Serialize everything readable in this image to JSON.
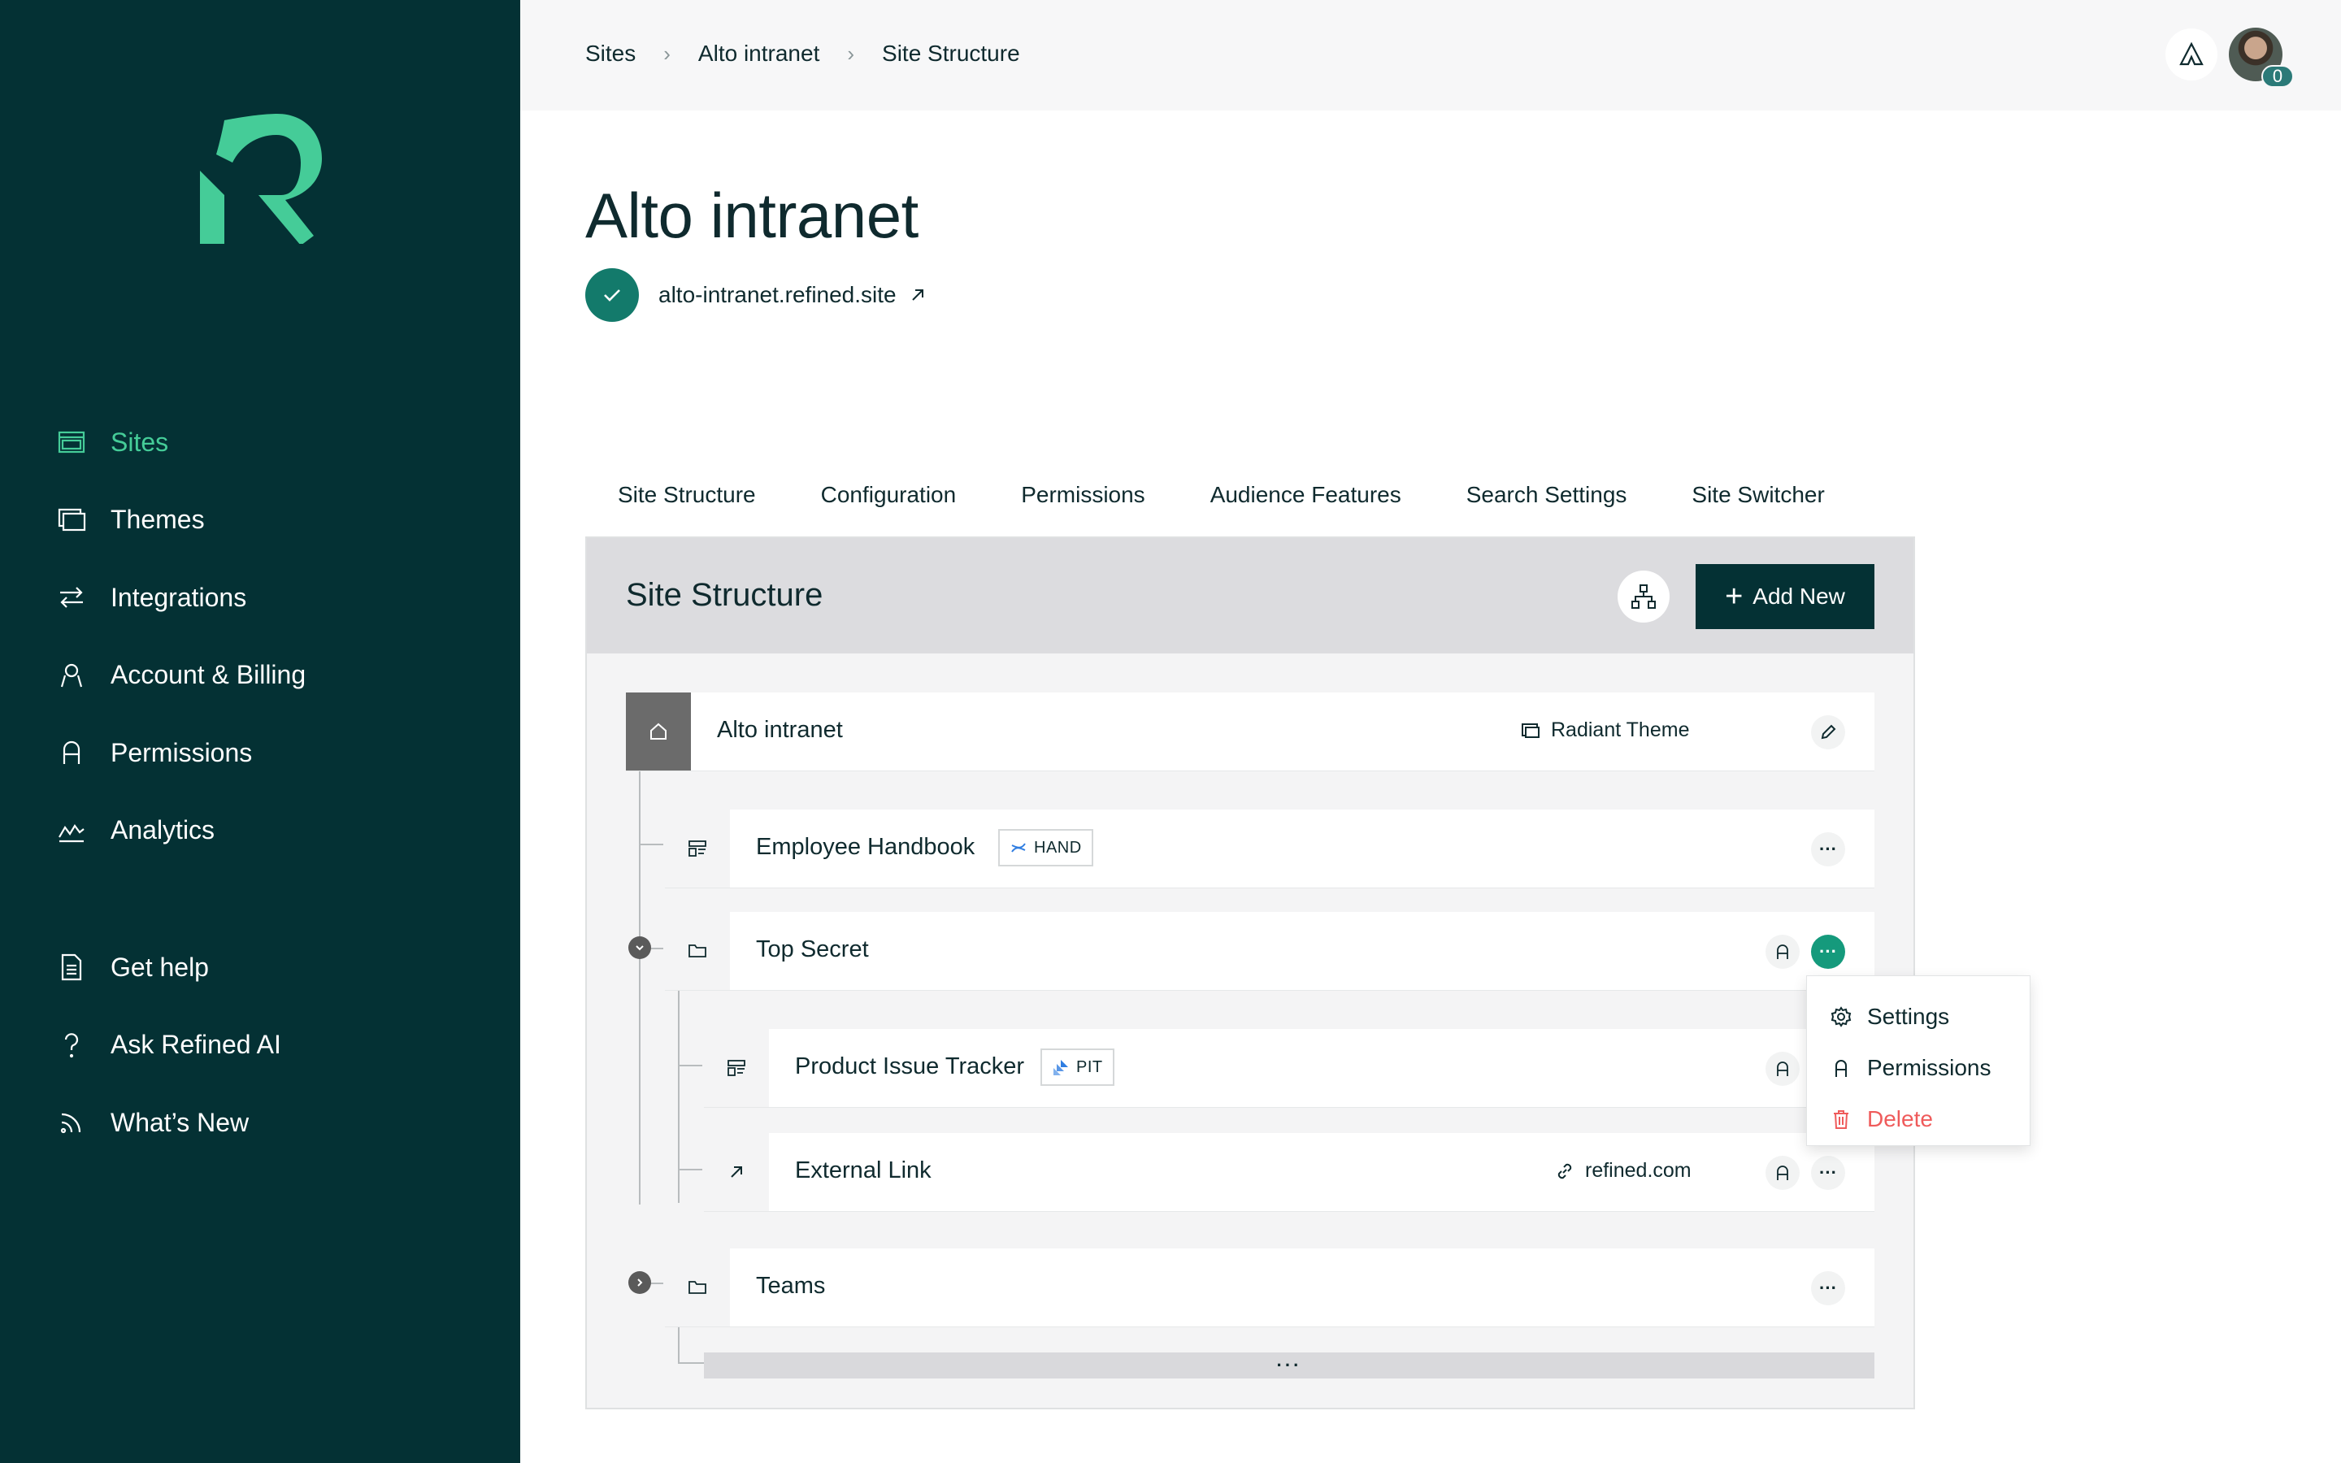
{
  "sidebar": {
    "brand_color": "#45cc98",
    "items": [
      {
        "label": "Sites",
        "icon": "sites-icon",
        "active": true
      },
      {
        "label": "Themes",
        "icon": "themes-icon"
      },
      {
        "label": "Integrations",
        "icon": "integrations-icon"
      },
      {
        "label": "Account & Billing",
        "icon": "account-icon"
      },
      {
        "label": "Permissions",
        "icon": "lock-icon"
      },
      {
        "label": "Analytics",
        "icon": "analytics-icon"
      }
    ],
    "help_items": [
      {
        "label": "Get help",
        "icon": "document-icon"
      },
      {
        "label": "Ask Refined AI",
        "icon": "question-icon"
      },
      {
        "label": "What’s New",
        "icon": "rss-icon"
      }
    ]
  },
  "breadcrumb": [
    "Sites",
    "Alto intranet",
    "Site Structure"
  ],
  "header": {
    "notification_count": "0"
  },
  "page": {
    "title": "Alto intranet",
    "url": "alto-intranet.refined.site"
  },
  "tabs": [
    {
      "label": "Site Structure",
      "active": true
    },
    {
      "label": "Configuration"
    },
    {
      "label": "Permissions"
    },
    {
      "label": "Audience Features"
    },
    {
      "label": "Search Settings"
    },
    {
      "label": "Site Switcher"
    }
  ],
  "panel": {
    "title": "Site Structure",
    "add_new_label": "Add New",
    "home": {
      "label": "Alto intranet",
      "theme": "Radiant Theme"
    },
    "rows": {
      "employee_handbook": {
        "label": "Employee Handbook",
        "tag": "HAND"
      },
      "top_secret": {
        "label": "Top Secret"
      },
      "product_issue_tracker": {
        "label": "Product Issue Tracker",
        "tag": "PIT"
      },
      "external_link": {
        "label": "External Link",
        "link": "refined.com"
      },
      "teams": {
        "label": "Teams"
      }
    },
    "more_label": "···"
  },
  "dropdown": {
    "items": [
      {
        "label": "Settings",
        "icon": "gear-icon"
      },
      {
        "label": "Permissions",
        "icon": "lock-icon"
      },
      {
        "label": "Delete",
        "icon": "trash-icon",
        "danger": true
      }
    ]
  },
  "colors": {
    "sidebar_bg": "#043134",
    "accent": "#45cc98",
    "primary_button": "#043134",
    "check_green": "#137a6b",
    "action_green": "#159a7c",
    "danger": "#ef5b5b"
  }
}
